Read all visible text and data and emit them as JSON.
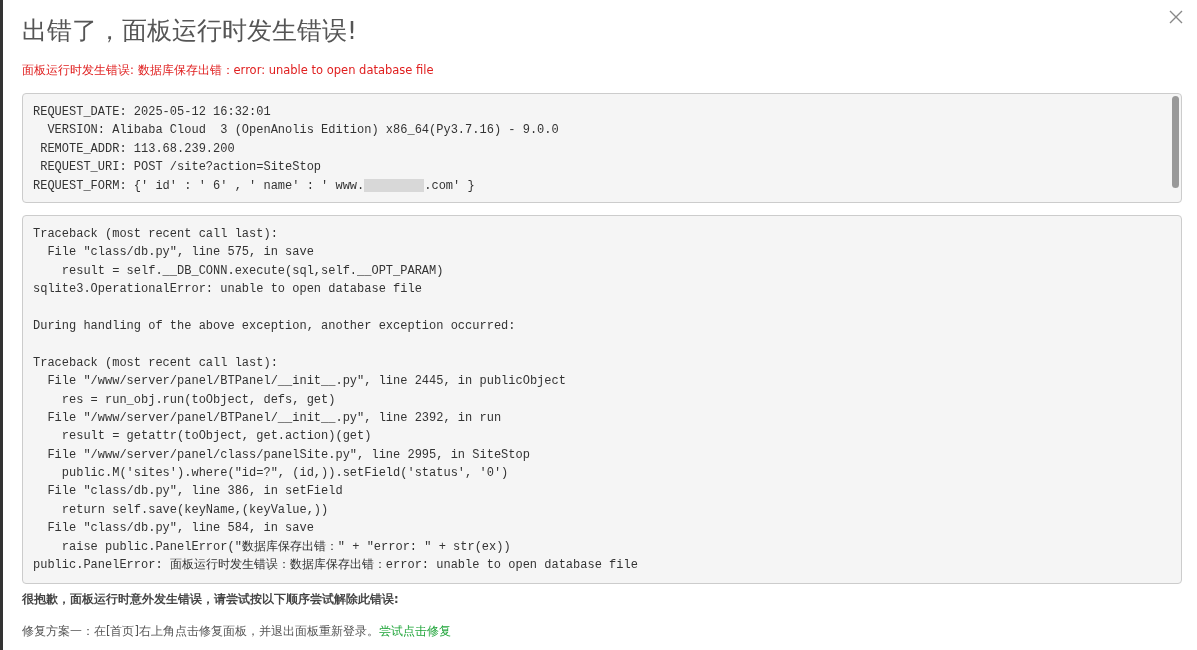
{
  "title": "出错了，面板运行时发生错误!",
  "error_summary": "面板运行时发生错误: 数据库保存出错：error: unable to open database file",
  "request_info": {
    "lines": [
      {
        "kind": "plain",
        "text": "REQUEST_DATE: 2025-05-12 16:32:01"
      },
      {
        "kind": "plain",
        "text": "  VERSION: Alibaba Cloud  3 (OpenAnolis Edition) x86_64(Py3.7.16) - 9.0.0"
      },
      {
        "kind": "plain",
        "text": " REMOTE_ADDR: 113.68.239.200"
      },
      {
        "kind": "plain",
        "text": " REQUEST_URI: POST /site?action=SiteStop"
      },
      {
        "kind": "redacted",
        "before": "REQUEST_FORM: {' id' : ' 6' , ' name' : ' www.",
        "after": ".com' }"
      }
    ]
  },
  "traceback": [
    [
      "Traceback (most recent call last):",
      "  File \"class/db.py\", line 575, in save",
      "    result = self.__DB_CONN.execute(sql,self.__OPT_PARAM)",
      "sqlite3.OperationalError: unable to open database file"
    ],
    [
      "During handling of the above exception, another exception occurred:"
    ],
    [
      "Traceback (most recent call last):",
      "  File \"/www/server/panel/BTPanel/__init__.py\", line 2445, in publicObject",
      "    res = run_obj.run(toObject, defs, get)",
      "  File \"/www/server/panel/BTPanel/__init__.py\", line 2392, in run",
      "    result = getattr(toObject, get.action)(get)",
      "  File \"/www/server/panel/class/panelSite.py\", line 2995, in SiteStop",
      "    public.M('sites').where(\"id=?\", (id,)).setField('status', '0')",
      "  File \"class/db.py\", line 386, in setField",
      "    return self.save(keyName,(keyValue,))",
      "  File \"class/db.py\", line 584, in save",
      "    raise public.PanelError(\"数据库保存出错：\" + \"error: \" + str(ex))",
      "public.PanelError: 面板运行时发生错误：数据库保存出错：error: unable to open database file"
    ]
  ],
  "apology": "很抱歉，面板运行时意外发生错误，请尝试按以下顺序尝试解除此错误:",
  "fix": {
    "text": "修复方案一：在[首页]右上角点击修复面板，并退出面板重新登录。",
    "link": "尝试点击修复"
  }
}
